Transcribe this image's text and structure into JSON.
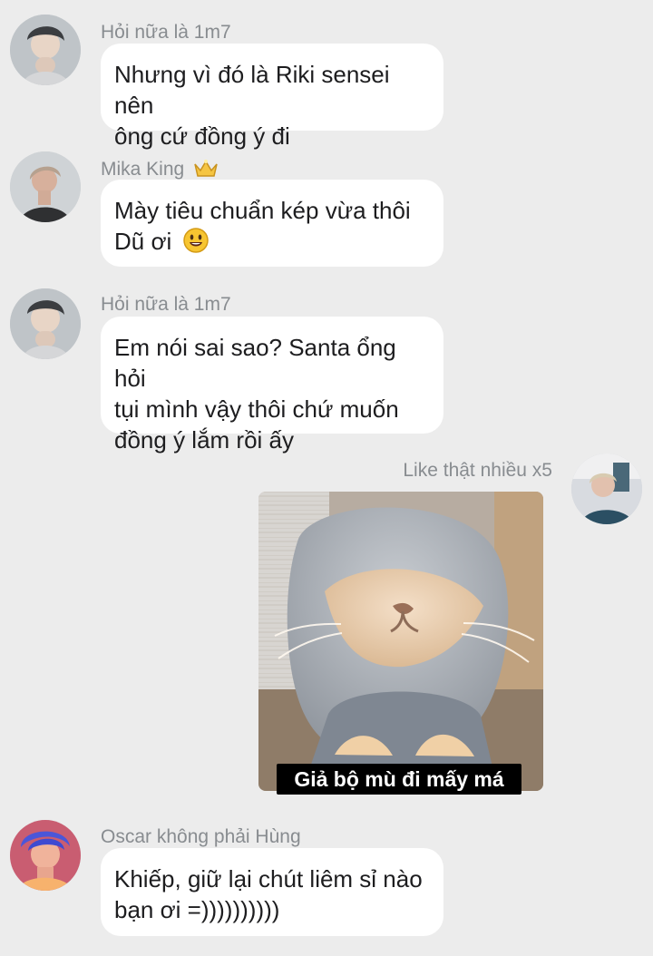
{
  "messages": [
    {
      "sender": "Hỏi nữa là 1m7",
      "lines": [
        "Nhưng vì đó là Riki sensei nên",
        "ông cứ đồng ý đi"
      ]
    },
    {
      "sender": "Mika King",
      "lines": [
        "Mày tiêu chuẩn kép vừa thôi",
        "Dũ ơi"
      ]
    },
    {
      "sender": "Hỏi nữa là 1m7",
      "lines": [
        "Em nói sai sao? Santa ổng hỏi",
        "tụi mình vậy thôi chứ muốn",
        "đồng ý lắm rồi ấy"
      ]
    },
    {
      "sender": "Like thật nhiều x5",
      "image_caption": "Giả bộ mù đi mấy má"
    },
    {
      "sender": "Oscar không phải Hùng",
      "lines": [
        "Khiếp, giữ lại chút liêm sỉ nào",
        "bạn ơi =))))))))))"
      ]
    }
  ],
  "icons": {
    "avatar_icon": "avatar-icon",
    "crown_icon": "crown-icon",
    "emoji_icon": "grinning-face-icon"
  },
  "colors": {
    "background": "#ececec",
    "bubble": "#ffffff",
    "sender_text": "#888c90",
    "message_text": "#1d1d1f"
  }
}
